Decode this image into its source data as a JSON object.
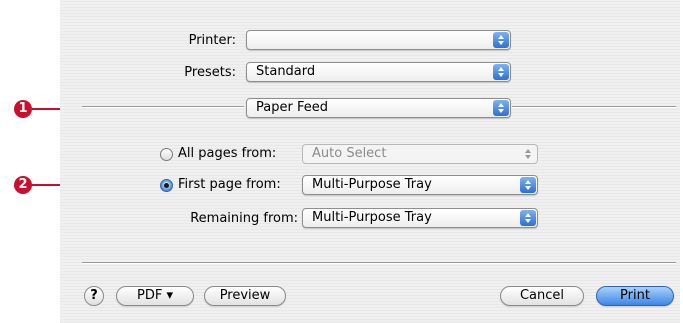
{
  "callouts": {
    "first": "1",
    "second": "2"
  },
  "printer": {
    "label": "Printer:",
    "value": ""
  },
  "presets": {
    "label": "Presets:",
    "value": "Standard"
  },
  "section": {
    "value": "Paper Feed"
  },
  "paper": {
    "all_pages": {
      "label": "All pages from:",
      "value": "Auto Select",
      "selected": false,
      "enabled": false
    },
    "first_page": {
      "label": "First page from:",
      "value": "Multi-Purpose Tray",
      "selected": true
    },
    "remaining": {
      "label": "Remaining from:",
      "value": "Multi-Purpose Tray"
    }
  },
  "footer": {
    "help": "?",
    "pdf": "PDF ▾",
    "preview": "Preview",
    "cancel": "Cancel",
    "print": "Print"
  },
  "colors": {
    "callout": "#c8102e",
    "accent": "#2f6fd1"
  }
}
